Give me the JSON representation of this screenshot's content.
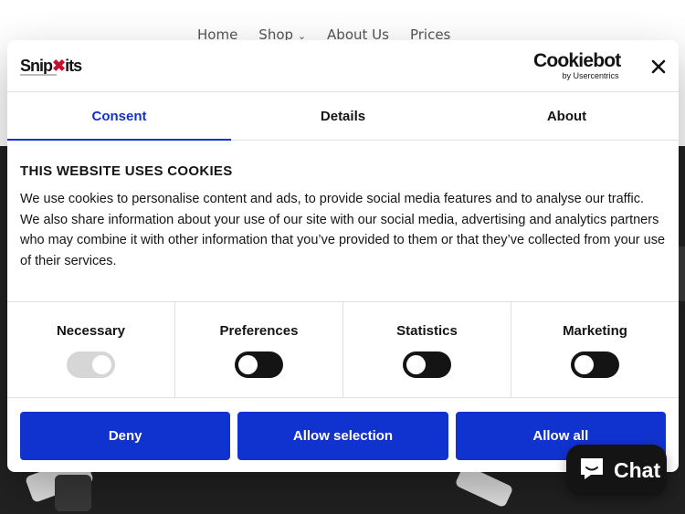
{
  "site": {
    "nav": [
      "Home",
      "Shop",
      "About Us",
      "Prices"
    ]
  },
  "dialog": {
    "logo": {
      "prefix": "Snip",
      "suffix": "its"
    },
    "provider": {
      "name": "Cookiebot",
      "sub": "by Usercentrics"
    },
    "tabs": [
      "Consent",
      "Details",
      "About"
    ],
    "active_tab": "Consent",
    "heading": "THIS WEBSITE USES COOKIES",
    "body": "We use cookies to personalise content and ads, to provide social media features and to analyse our traffic. We also share information about your use of our site with our social media, advertising and analytics partners who may combine it with other information that you’ve provided to them or that they’ve collected from your use of their services.",
    "categories": [
      {
        "label": "Necessary",
        "enabled": true,
        "locked": true
      },
      {
        "label": "Preferences",
        "enabled": false,
        "locked": false
      },
      {
        "label": "Statistics",
        "enabled": false,
        "locked": false
      },
      {
        "label": "Marketing",
        "enabled": false,
        "locked": false
      }
    ],
    "buttons": {
      "deny": "Deny",
      "allow_selection": "Allow selection",
      "allow_all": "Allow all"
    }
  },
  "chat": {
    "label": "Chat"
  },
  "colors": {
    "accent": "#1032cf",
    "dark": "#141414",
    "brand_red": "#c8102e"
  }
}
